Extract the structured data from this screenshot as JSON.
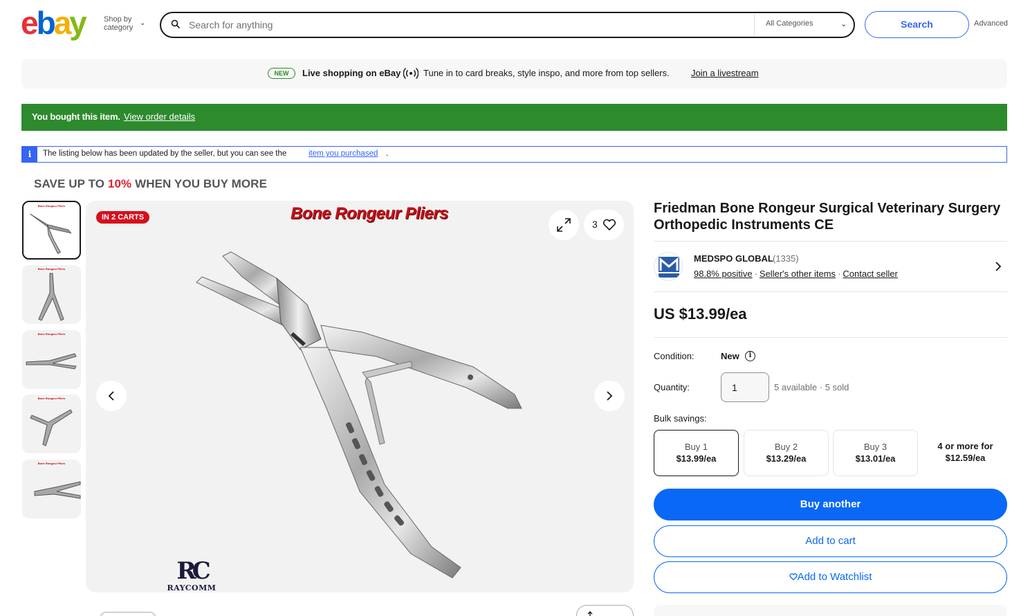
{
  "header": {
    "shop_by_line1": "Shop by",
    "shop_by_line2": "category",
    "search_placeholder": "Search for anything",
    "category_select": "All Categories",
    "search_button": "Search",
    "advanced": "Advanced"
  },
  "promo": {
    "badge": "NEW",
    "title": "Live shopping on eBay",
    "text": "Tune in to card breaks, style inspo, and more from top sellers.",
    "link": "Join a livestream"
  },
  "bought_banner": {
    "text": "You bought this item.",
    "link": "View order details"
  },
  "info_bar": {
    "text": "The listing below has been updated by the seller, but you can see the",
    "link": "item you purchased",
    "suffix": "."
  },
  "save_banner": {
    "prefix": "SAVE UP TO",
    "percent": "10%",
    "suffix": "WHEN YOU BUY MORE"
  },
  "gallery": {
    "badge": "IN 2 CARTS",
    "image_title": "Bone Rongeur Pliers",
    "watch_count": "3",
    "brand_mark": "RC",
    "brand_name": "RAYCOMM",
    "thumbnail_caption": "Bone Rongeur Pliers"
  },
  "product": {
    "title": "Friedman Bone Rongeur Surgical Veterinary Surgery Orthopedic Instruments CE",
    "price": "US $13.99/ea"
  },
  "seller": {
    "name": "MEDSPO GLOBAL",
    "score": "(1335)",
    "positive": "98.8% positive",
    "other_items": "Seller's other items",
    "contact": "Contact seller"
  },
  "details": {
    "condition_label": "Condition:",
    "condition_value": "New",
    "quantity_label": "Quantity:",
    "quantity_value": "1",
    "availability": "5 available · 5 sold",
    "bulk_label": "Bulk savings:"
  },
  "bulk_options": [
    {
      "qty": "Buy 1",
      "price": "$13.99/ea"
    },
    {
      "qty": "Buy 2",
      "price": "$13.29/ea"
    },
    {
      "qty": "Buy 3",
      "price": "$13.01/ea"
    },
    {
      "qty": "4 or more for",
      "price": "$12.59/ea"
    }
  ],
  "actions": {
    "buy": "Buy another",
    "cart": "Add to cart",
    "watch": "Add to Watchlist"
  },
  "colors": {
    "ebay_e": "#e53238",
    "ebay_b": "#0064d2",
    "ebay_a": "#f5af02",
    "ebay_y": "#86b817",
    "primary_blue": "#0968f6",
    "success_green": "#2d8a2d",
    "alert_red": "#d4101e"
  }
}
